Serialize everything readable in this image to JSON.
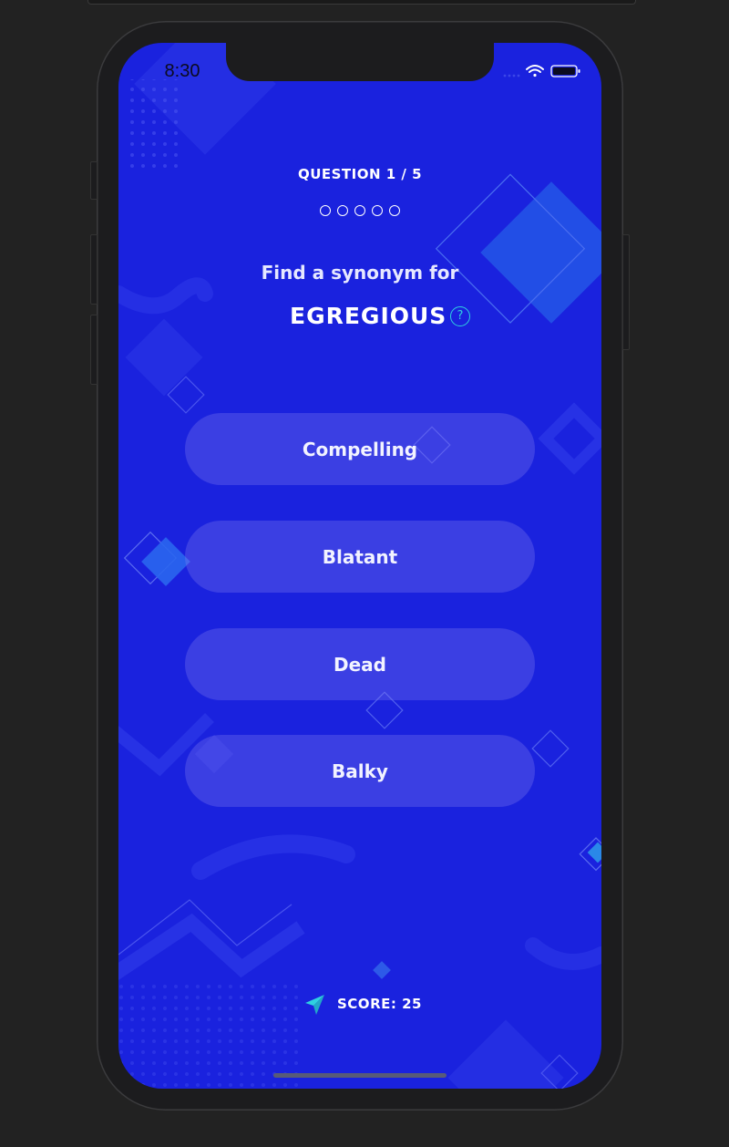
{
  "status_bar": {
    "time": "8:30"
  },
  "quiz": {
    "counter": "QUESTION 1 / 5",
    "progress": {
      "current": 1,
      "total": 5
    },
    "prompt": "Find a synonym for",
    "word": "EGREGIOUS",
    "help_symbol": "?",
    "answers": [
      {
        "label": "Compelling"
      },
      {
        "label": "Blatant"
      },
      {
        "label": "Dead"
      },
      {
        "label": "Balky"
      }
    ]
  },
  "footer": {
    "score": "SCORE: 25",
    "icon": "send-icon"
  },
  "colors": {
    "background": "#1a22de",
    "accent": "#2fd0e0",
    "button": "#5b58e6",
    "frame": "#1c1c1e"
  }
}
